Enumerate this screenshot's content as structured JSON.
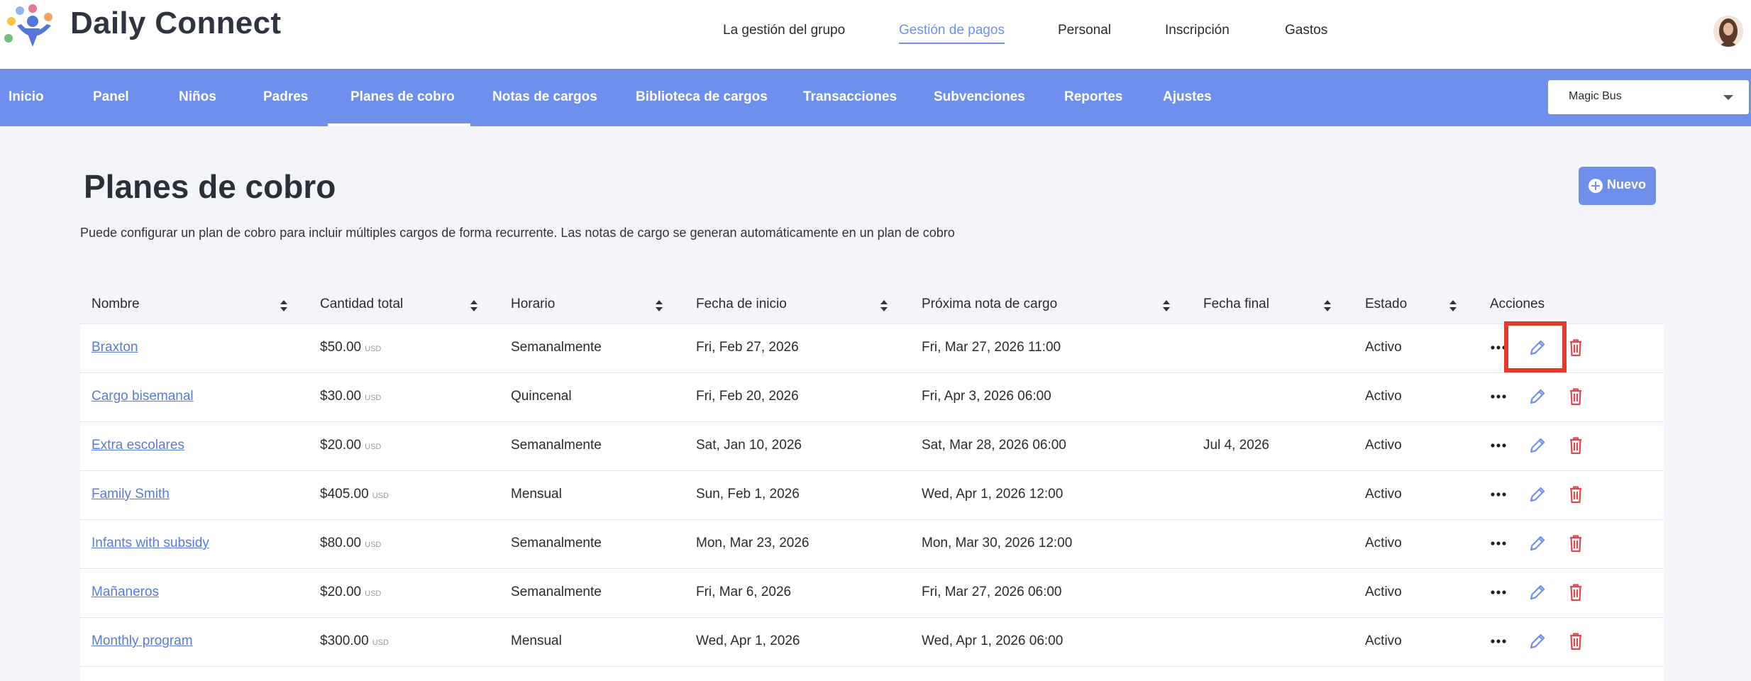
{
  "brand": {
    "name": "Daily Connect"
  },
  "top_nav": [
    {
      "label": "La gestión del grupo",
      "active": false
    },
    {
      "label": "Gestión de pagos",
      "active": true
    },
    {
      "label": "Personal",
      "active": false
    },
    {
      "label": "Inscripción",
      "active": false
    },
    {
      "label": "Gastos",
      "active": false
    }
  ],
  "sub_nav": [
    {
      "label": "Inicio",
      "active": false
    },
    {
      "label": "Panel",
      "active": false
    },
    {
      "label": "Niños",
      "active": false
    },
    {
      "label": "Padres",
      "active": false
    },
    {
      "label": "Planes de cobro",
      "active": true
    },
    {
      "label": "Notas de cargos",
      "active": false
    },
    {
      "label": "Biblioteca de cargos",
      "active": false
    },
    {
      "label": "Transacciones",
      "active": false
    },
    {
      "label": "Subvenciones",
      "active": false
    },
    {
      "label": "Reportes",
      "active": false
    },
    {
      "label": "Ajustes",
      "active": false
    }
  ],
  "program_select": {
    "value": "Magic Bus"
  },
  "page": {
    "title": "Planes de cobro",
    "description": "Puede configurar un plan de cobro para incluir múltiples cargos de forma recurrente. Las notas de cargo se generan automáticamente en un plan de cobro",
    "new_button": "Nuevo"
  },
  "table": {
    "columns": [
      "Nombre",
      "Cantidad total",
      "Horario",
      "Fecha de inicio",
      "Próxima nota de cargo",
      "Fecha final",
      "Estado",
      "Acciones"
    ],
    "currency": "USD",
    "rows": [
      {
        "name": "Braxton",
        "amount": "$50.00",
        "schedule": "Semanalmente",
        "start": "Fri, Feb 27, 2026",
        "next": "Fri, Mar 27, 2026 11:00",
        "end": "",
        "status": "Activo"
      },
      {
        "name": "Cargo bisemanal",
        "amount": "$30.00",
        "schedule": "Quincenal",
        "start": "Fri, Feb 20, 2026",
        "next": "Fri, Apr 3, 2026 06:00",
        "end": "",
        "status": "Activo"
      },
      {
        "name": "Extra escolares",
        "amount": "$20.00",
        "schedule": "Semanalmente",
        "start": "Sat, Jan 10, 2026",
        "next": "Sat, Mar 28, 2026 06:00",
        "end": "Jul 4, 2026",
        "status": "Activo"
      },
      {
        "name": "Family Smith",
        "amount": "$405.00",
        "schedule": "Mensual",
        "start": "Sun, Feb 1, 2026",
        "next": "Wed, Apr 1, 2026 12:00",
        "end": "",
        "status": "Activo"
      },
      {
        "name": "Infants with subsidy",
        "amount": "$80.00",
        "schedule": "Semanalmente",
        "start": "Mon, Mar 23, 2026",
        "next": "Mon, Mar 30, 2026 12:00",
        "end": "",
        "status": "Activo"
      },
      {
        "name": "Mañaneros",
        "amount": "$20.00",
        "schedule": "Semanalmente",
        "start": "Fri, Mar 6, 2026",
        "next": "Fri, Mar 27, 2026 06:00",
        "end": "",
        "status": "Activo"
      },
      {
        "name": "Monthly program",
        "amount": "$300.00",
        "schedule": "Mensual",
        "start": "Wed, Apr 1, 2026",
        "next": "Wed, Apr 1, 2026 06:00",
        "end": "",
        "status": "Activo"
      }
    ]
  },
  "colors": {
    "accent": "#6f8fed",
    "link": "#5a79dc",
    "delete": "#e0474c",
    "highlight": "#e5392b"
  }
}
